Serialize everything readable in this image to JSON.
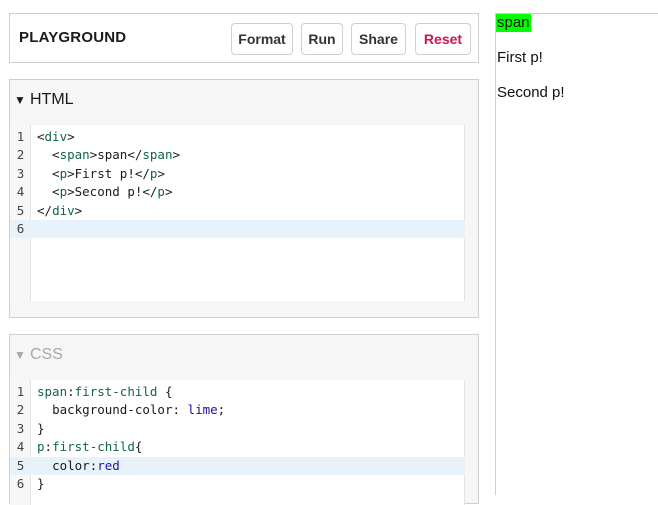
{
  "toolbar": {
    "title": "PLAYGROUND",
    "format_label": "Format",
    "run_label": "Run",
    "share_label": "Share",
    "reset_label": "Reset",
    "reset_color": "#c8174d"
  },
  "html_panel": {
    "title": "HTML",
    "arrow": "▼",
    "line_numbers": [
      "1",
      "2",
      "3",
      "4",
      "5",
      "6"
    ],
    "lines": [
      "<div>",
      "  <span>span</span>",
      "  <p>First p!</p>",
      "  <p>Second p!</p>",
      "</div>",
      ""
    ],
    "active_line": 6
  },
  "css_panel": {
    "title": "CSS",
    "arrow": "▼",
    "line_numbers": [
      "1",
      "2",
      "3",
      "4",
      "5",
      "6"
    ],
    "lines": [
      "span:first-child {",
      "  background-color: lime;",
      "}",
      "p:first-child{",
      "  color:red",
      "}"
    ],
    "active_line": 5
  },
  "preview": {
    "span_text": "span",
    "p1_text": "First p!",
    "p2_text": "Second p!",
    "highlight_color": "#00ff00"
  }
}
